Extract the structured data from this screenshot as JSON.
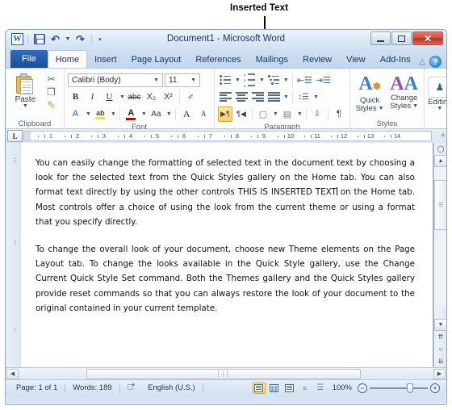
{
  "annotation": {
    "label": "Inserted Text"
  },
  "window": {
    "title": "Document1  -  Microsoft Word",
    "app_logo": "W",
    "quick_access": [
      {
        "name": "save-icon",
        "label": "Save"
      },
      {
        "name": "undo-icon",
        "label": "Undo"
      },
      {
        "name": "redo-icon",
        "label": "Redo"
      },
      {
        "name": "customize-qat-icon",
        "label": "Customize Quick Access Toolbar"
      }
    ],
    "controls": [
      {
        "name": "minimize-button",
        "label": "Minimize"
      },
      {
        "name": "restore-button",
        "label": "Restore Down"
      },
      {
        "name": "close-button",
        "label": "Close",
        "glyph": "✕",
        "color": "#d4493b"
      }
    ]
  },
  "tabs": [
    {
      "label": "File",
      "state": "file"
    },
    {
      "label": "Home",
      "state": "active"
    },
    {
      "label": "Insert",
      "state": "normal"
    },
    {
      "label": "Page Layout",
      "state": "normal"
    },
    {
      "label": "References",
      "state": "normal"
    },
    {
      "label": "Mailings",
      "state": "normal"
    },
    {
      "label": "Review",
      "state": "normal"
    },
    {
      "label": "View",
      "state": "normal"
    },
    {
      "label": "Add-Ins",
      "state": "normal"
    }
  ],
  "tab_right": {
    "minimize_ribbon": "△",
    "help": "?"
  },
  "ribbon": {
    "clipboard": {
      "label": "Clipboard",
      "paste_label": "Paste",
      "items": [
        {
          "name": "cut-icon",
          "label": "Cut",
          "glyph": "✂"
        },
        {
          "name": "copy-icon",
          "label": "Copy",
          "glyph": "❐"
        },
        {
          "name": "format-painter-icon",
          "label": "Format Painter",
          "glyph": "✎"
        }
      ]
    },
    "font": {
      "label": "Font",
      "font_name": "Calibri (Body)",
      "font_size": "11",
      "row1": [
        {
          "name": "bold-button",
          "label": "B"
        },
        {
          "name": "italic-button",
          "label": "I"
        },
        {
          "name": "underline-button",
          "label": "U"
        },
        {
          "name": "strikethrough-button",
          "label": "abc"
        },
        {
          "name": "subscript-button",
          "label": "X₂"
        },
        {
          "name": "superscript-button",
          "label": "X²"
        },
        {
          "name": "clear-formatting-button",
          "label": "✐"
        }
      ],
      "row2": [
        {
          "name": "text-effects-button",
          "label": "A"
        },
        {
          "name": "text-highlight-color-button",
          "label": "ab"
        },
        {
          "name": "font-color-button",
          "label": "A"
        },
        {
          "name": "change-case-button",
          "label": "Aa"
        },
        {
          "name": "grow-font-button",
          "label": "A"
        },
        {
          "name": "shrink-font-button",
          "label": "A"
        }
      ]
    },
    "paragraph": {
      "label": "Paragraph",
      "row1": [
        {
          "name": "bullets-button",
          "label": "Bullets"
        },
        {
          "name": "numbering-button",
          "label": "Numbering"
        },
        {
          "name": "multilevel-list-button",
          "label": "Multilevel List"
        },
        {
          "name": "decrease-indent-button",
          "label": "Decrease Indent"
        },
        {
          "name": "increase-indent-button",
          "label": "Increase Indent"
        }
      ],
      "row2": [
        {
          "name": "align-left-button",
          "label": "Align Left"
        },
        {
          "name": "center-button",
          "label": "Center"
        },
        {
          "name": "align-right-button",
          "label": "Align Right"
        },
        {
          "name": "justify-button",
          "label": "Justify"
        },
        {
          "name": "line-spacing-button",
          "label": "Line and Paragraph Spacing"
        }
      ],
      "row3": [
        {
          "name": "ltr-text-direction-button",
          "label": "▶¶",
          "active": true
        },
        {
          "name": "rtl-text-direction-button",
          "label": "¶◀",
          "active": false
        },
        {
          "name": "shading-button",
          "label": "Shading"
        },
        {
          "name": "borders-button",
          "label": "Borders"
        },
        {
          "name": "sort-button",
          "label": "Sort"
        },
        {
          "name": "show-formatting-marks-button",
          "label": "¶"
        }
      ]
    },
    "styles": {
      "label": "Styles",
      "items": [
        {
          "name": "quick-styles-button",
          "line1": "Quick",
          "line2": "Styles"
        },
        {
          "name": "change-styles-button",
          "line1": "Change",
          "line2": "Styles"
        }
      ]
    },
    "editing": {
      "label": "Editing",
      "button_label": "Editing",
      "icon": "♟"
    }
  },
  "ruler": {
    "tab_selector": "L",
    "ticks": [
      "1",
      "2",
      "3",
      "4",
      "5",
      "6",
      "7",
      "8",
      "9",
      "10",
      "11",
      "12",
      "13",
      "14"
    ]
  },
  "document": {
    "paragraphs": [
      "You can easily change the formatting of selected text in the document text by choosing a look for the selected text from the Quick Styles gallery on the Home tab. You can also format text directly by using the other controls THIS IS INSERTED TEXT on the Home tab. Most controls offer a choice of using the look from the current theme or using a format that you specify directly.",
      "To change the overall look of your document, choose new Theme elements on the Page Layout tab. To change the looks available in the Quick Style gallery, use the Change Current Quick Style Set command. Both the Themes gallery and the Quick Styles gallery provide reset commands so that you can always restore the look of your document to the original contained in your current template."
    ],
    "inserted_text": "THIS IS INSERTED TEXT"
  },
  "statusbar": {
    "page": "Page: 1 of 1",
    "words": "Words: 189",
    "proofing_icon": "spell-check-icon",
    "language": "English (U.S.)",
    "views": [
      {
        "name": "print-layout-view-button",
        "label": "Print Layout",
        "active": true
      },
      {
        "name": "full-screen-reading-view-button",
        "label": "Full Screen Reading",
        "active": false
      },
      {
        "name": "web-layout-view-button",
        "label": "Web Layout",
        "active": false
      },
      {
        "name": "outline-view-button",
        "label": "Outline",
        "active": false
      },
      {
        "name": "draft-view-button",
        "label": "Draft",
        "active": false
      }
    ],
    "zoom": "100%",
    "zoom_out": "−",
    "zoom_in": "+"
  }
}
